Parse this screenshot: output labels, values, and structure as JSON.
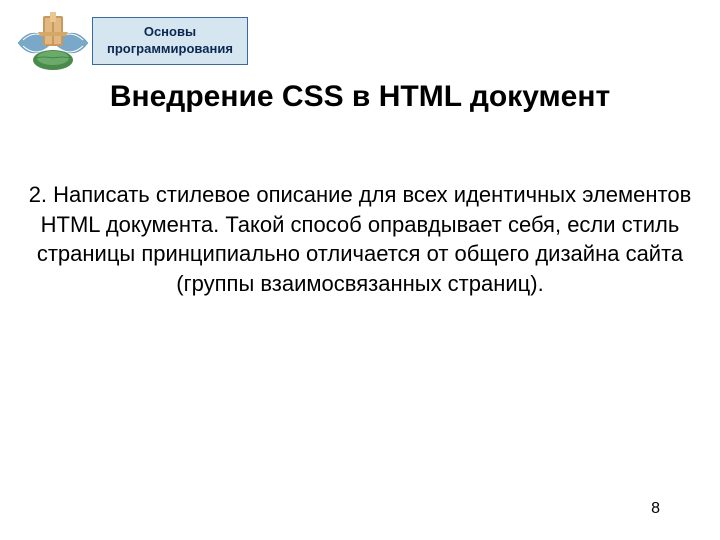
{
  "header": {
    "badge_line1": "Основы",
    "badge_line2": "программирования"
  },
  "title": "Внедрение CSS в HTML документ",
  "body": "2. Написать стилевое описание для всех идентичных элементов HTML документа. Такой способ оправдывает себя, если стиль страницы принципиально отличается от общего дизайна сайта (группы взаимосвязанных страниц).",
  "page_number": "8"
}
